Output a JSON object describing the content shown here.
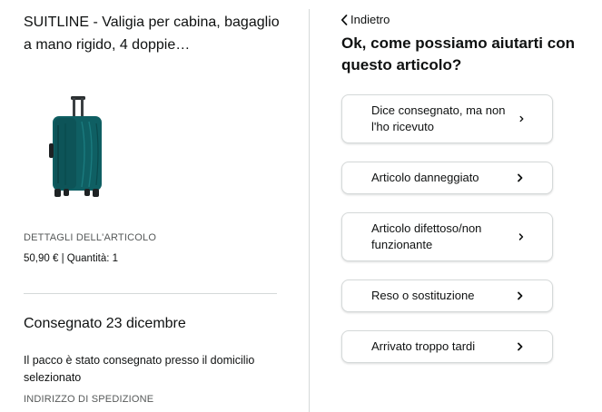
{
  "product": {
    "title": "SUITLINE - Valigia per cabina, bagaglio a mano rigido, 4 doppie…",
    "details_label": "DETTAGLI DELL'ARTICOLO",
    "price": "50,90 €",
    "quantity": "Quantità: 1"
  },
  "delivery": {
    "status": "Consegnato 23 dicembre",
    "message": "Il pacco è stato consegnato presso il domicilio selezionato",
    "shipping_label": "INDIRIZZO DI SPEDIZIONE"
  },
  "help": {
    "back_label": "Indietro",
    "question": "Ok, come possiamo aiutarti con questo articolo?",
    "options": [
      {
        "label": "Dice consegnato, ma non l'ho ricevuto"
      },
      {
        "label": "Articolo danneggiato"
      },
      {
        "label": "Articolo difettoso/non funzionante"
      },
      {
        "label": "Reso o sostituzione"
      },
      {
        "label": "Arrivato troppo tardi"
      }
    ]
  },
  "icons": {
    "back": "chevron-left-icon",
    "option": "chevron-right-icon",
    "product": "suitcase-image"
  },
  "colors": {
    "text": "#0f1111",
    "muted": "#565959",
    "border": "#d5d9d9",
    "suitcase": "#0f5f63"
  }
}
